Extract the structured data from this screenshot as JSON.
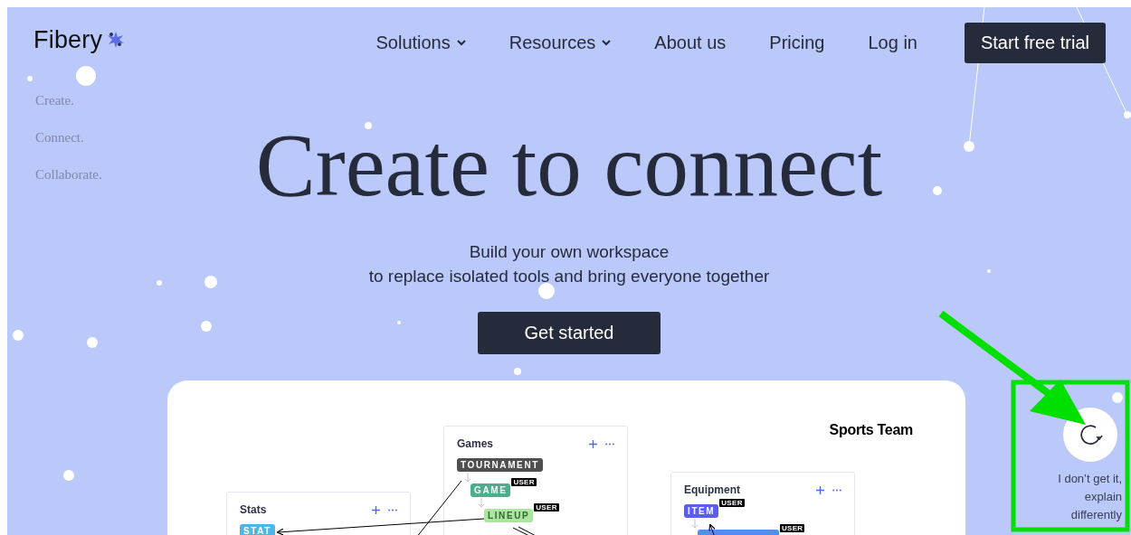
{
  "nav": {
    "logo": "Fibery",
    "items": [
      {
        "label": "Solutions",
        "dropdown": true
      },
      {
        "label": "Resources",
        "dropdown": true
      },
      {
        "label": "About us",
        "dropdown": false
      },
      {
        "label": "Pricing",
        "dropdown": false
      },
      {
        "label": "Log in",
        "dropdown": false
      }
    ],
    "cta": "Start free trial"
  },
  "taglines": [
    "Create.",
    "Connect.",
    "Collaborate."
  ],
  "hero": {
    "title": "Create to connect",
    "subtitle": [
      "Build your own workspace",
      "to replace isolated tools and bring everyone together"
    ],
    "button": "Get started"
  },
  "diagram": {
    "title": "Sports Team",
    "panels": [
      {
        "title": "Stats",
        "nodes": [
          {
            "label": "STAT",
            "color": "#4db6e4"
          }
        ]
      },
      {
        "title": "Games",
        "nodes": [
          {
            "label": "TOURNAMENT",
            "color": "#4f4f4f"
          },
          {
            "label": "GAME",
            "color": "#4cae8c",
            "badge": "USER"
          },
          {
            "label": "LINEUP",
            "color": "#ace59f",
            "badge": "USER"
          }
        ]
      },
      {
        "title": "Equipment",
        "nodes": [
          {
            "label": "ITEM",
            "color": "#5a5fe6",
            "badge": "USER"
          },
          {
            "color": "#4e8ff0",
            "badge": "USER"
          }
        ]
      }
    ]
  },
  "help": {
    "label": "I don’t get it, explain differently"
  }
}
